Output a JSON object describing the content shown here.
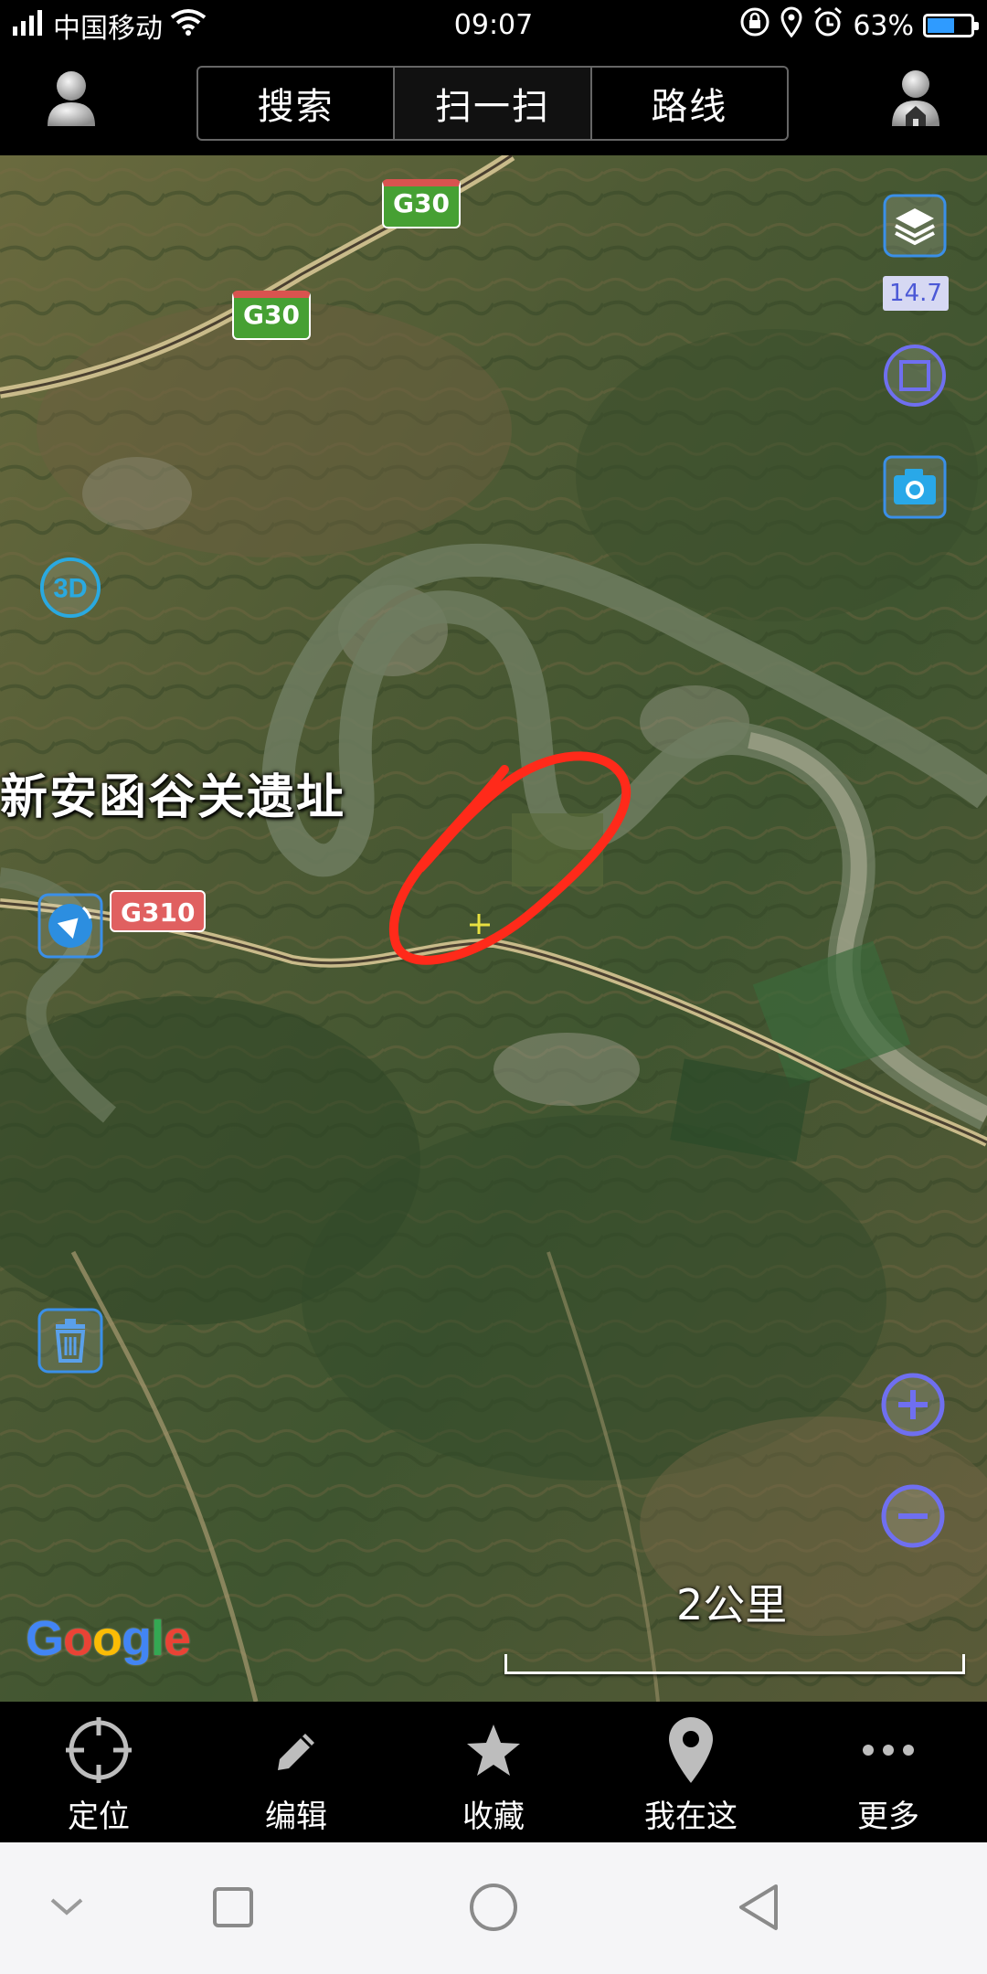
{
  "status_bar": {
    "carrier": "中国移动",
    "time": "09:07",
    "battery": "63%",
    "battery_level": 0.63
  },
  "header": {
    "tabs": [
      {
        "label": "搜索"
      },
      {
        "label": "扫一扫"
      },
      {
        "label": "路线"
      }
    ]
  },
  "map": {
    "road_labels": [
      "G30",
      "G30",
      "G310"
    ],
    "place_label": "新安函谷关遗址",
    "zoom_level": "14.7",
    "mode_3d_label": "3D",
    "scale_label": "2公里",
    "provider_logo": "Google",
    "annotation_color": "#ff2a1a",
    "controls": [
      "layers-icon",
      "square-select-icon",
      "camera-icon",
      "3d-toggle-icon",
      "compass-icon",
      "trash-icon",
      "zoom-in-icon",
      "zoom-out-icon"
    ]
  },
  "toolbar": {
    "items": [
      {
        "label": "定位",
        "icon": "crosshair-icon"
      },
      {
        "label": "编辑",
        "icon": "pencil-icon"
      },
      {
        "label": "收藏",
        "icon": "star-icon"
      },
      {
        "label": "我在这",
        "icon": "location-pin-icon"
      },
      {
        "label": "更多",
        "icon": "more-dots-icon"
      }
    ]
  },
  "colors": {
    "accent": "#6f6ff0",
    "control_blue": "#3a8fe8",
    "road_shield_green": "#46a033",
    "road_shield_red": "#e06060"
  }
}
